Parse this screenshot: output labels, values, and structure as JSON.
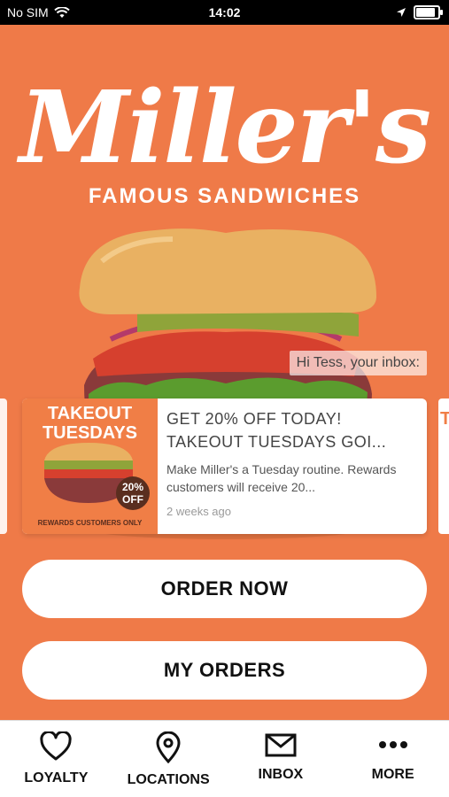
{
  "status_bar": {
    "carrier": "No SIM",
    "time": "14:02",
    "battery_level": 0.95
  },
  "brand": {
    "logo_text": "Miller's",
    "tagline": "FAMOUS SANDWICHES"
  },
  "inbox": {
    "greeting": "Hi Tess, your inbox:",
    "message": {
      "title": "GET 20% OFF TODAY! TAKEOUT TUESDAYS GOI...",
      "description": "Make Miller's a Tuesday routine. Rewards customers will receive 20...",
      "time": "2 weeks ago",
      "image": {
        "headline": "TAKEOUT TUESDAYS",
        "badge": "20% OFF",
        "footer": "REWARDS CUSTOMERS ONLY"
      }
    },
    "next_card_peek": "T"
  },
  "actions": {
    "order_now": "ORDER NOW",
    "my_orders": "MY ORDERS"
  },
  "tabs": [
    {
      "label": "LOYALTY",
      "icon": "heart-icon"
    },
    {
      "label": "LOCATIONS",
      "icon": "location-pin-icon"
    },
    {
      "label": "INBOX",
      "icon": "envelope-icon"
    },
    {
      "label": "MORE",
      "icon": "more-dots-icon"
    }
  ],
  "colors": {
    "brand_orange": "#ef7a48",
    "white": "#ffffff",
    "text_dark": "#111111"
  }
}
